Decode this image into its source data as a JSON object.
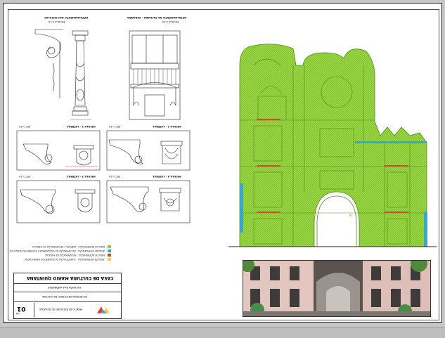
{
  "sheet": {
    "sheet_number": "01",
    "total_sheets": "04"
  },
  "detail_titles": {
    "top_left": "DETALHAMENTO DAS MÍSULAS",
    "top_left_sub": "ESCALA 1:25",
    "top_right": "DETALHAMENTO DA FACHADA - VARANDA",
    "top_right_sub": "ESCALA 1:25",
    "row2_left": "MÍSULA 1 - LATERAL",
    "row2_right": "MÍSULA 2 - LATERAL",
    "row3_left": "MÍSULA 3 - LATERAL",
    "row3_right": "MÍSULA 4 - LATERAL",
    "scale": "ESC 1:25"
  },
  "legend": [
    {
      "text": "ÁREA DE INTERVENÇÃO - LIMPEZA E RECUPERAÇÃO DO REBOCO",
      "color": "#8fd13a"
    },
    {
      "text": "ÁREA DE INTERVENÇÃO - RECUPERAÇÃO DE ESQUADRIAS E ELEMENTOS METÁLICOS",
      "color": "#2fa8e0"
    },
    {
      "text": "ÁREA DE INTERVENÇÃO - RECUPERAÇÃO DE MÍSULAS",
      "color": "#e53a2f"
    },
    {
      "text": "ÁREA DE INTERVENÇÃO - SUBSTITUIÇÃO DE ELEMENTOS DANIFICADOS",
      "color": "#f3d23a"
    }
  ],
  "title_block": {
    "project": "CASA DE CULTURA MÁRIO QUINTANA",
    "drawing": "FACHADA RUA ANDRADAS",
    "institution": "SECRETARIA DE ESTADO DA CULTURA",
    "notes": "PROJETO DE RESTAURO DE FACHADAS"
  },
  "colors": {
    "facade_green": "#95d43f",
    "facade_line": "#5e9a1e",
    "blue": "#2fa8e0",
    "red": "#e53a2f"
  }
}
